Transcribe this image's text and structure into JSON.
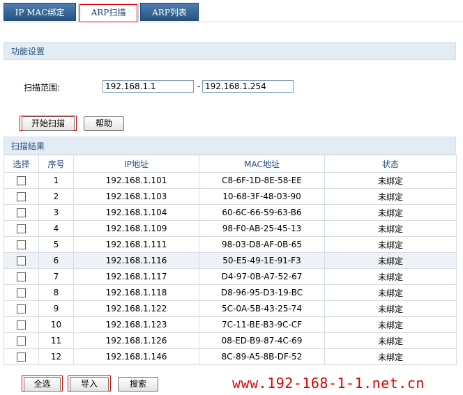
{
  "tabs": [
    {
      "label": "IP MAC绑定"
    },
    {
      "label": "ARP扫描"
    },
    {
      "label": "ARP列表"
    }
  ],
  "function_settings": {
    "title": "功能设置",
    "scan_range_label": "扫描范围:",
    "start_ip": "192.168.1.1",
    "separator": "-",
    "end_ip": "192.168.1.254",
    "start_scan_label": "开始扫描",
    "help_label": "帮助"
  },
  "results": {
    "title": "扫描结果",
    "columns": [
      "选择",
      "序号",
      "IP地址",
      "MAC地址",
      "状态"
    ],
    "rows": [
      {
        "no": "1",
        "ip": "192.168.1.101",
        "mac": "C8-6F-1D-8E-58-EE",
        "status": "未绑定"
      },
      {
        "no": "2",
        "ip": "192.168.1.103",
        "mac": "10-68-3F-48-03-90",
        "status": "未绑定"
      },
      {
        "no": "3",
        "ip": "192.168.1.104",
        "mac": "60-6C-66-59-63-B6",
        "status": "未绑定"
      },
      {
        "no": "4",
        "ip": "192.168.1.109",
        "mac": "98-F0-AB-25-45-13",
        "status": "未绑定"
      },
      {
        "no": "5",
        "ip": "192.168.1.111",
        "mac": "98-03-D8-AF-0B-65",
        "status": "未绑定"
      },
      {
        "no": "6",
        "ip": "192.168.1.116",
        "mac": "50-E5-49-1E-91-F3",
        "status": "未绑定"
      },
      {
        "no": "7",
        "ip": "192.168.1.117",
        "mac": "D4-97-0B-A7-52-67",
        "status": "未绑定"
      },
      {
        "no": "8",
        "ip": "192.168.1.118",
        "mac": "D8-96-95-D3-19-BC",
        "status": "未绑定"
      },
      {
        "no": "9",
        "ip": "192.168.1.122",
        "mac": "5C-0A-5B-43-25-74",
        "status": "未绑定"
      },
      {
        "no": "10",
        "ip": "192.168.1.123",
        "mac": "7C-11-BE-B3-9C-CF",
        "status": "未绑定"
      },
      {
        "no": "11",
        "ip": "192.168.1.126",
        "mac": "08-ED-B9-87-4C-69",
        "status": "未绑定"
      },
      {
        "no": "12",
        "ip": "192.168.1.146",
        "mac": "8C-89-A5-8B-DF-52",
        "status": "未绑定"
      }
    ]
  },
  "bottom_buttons": {
    "select_all": "全选",
    "import": "导入",
    "search": "搜索"
  },
  "watermark": "www.192-168-1-1.net.cn",
  "colors": {
    "tab_blue": "#24507f",
    "section_bg": "#e3ecf4",
    "highlight_red": "#e00000",
    "alt_row": "#eef2f6"
  }
}
